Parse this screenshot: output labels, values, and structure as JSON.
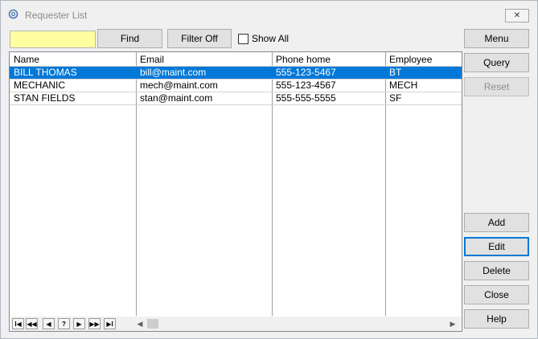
{
  "window": {
    "title": "Requester List",
    "close_label": "✕"
  },
  "toolbar": {
    "search_value": "",
    "find_label": "Find",
    "filter_label": "Filter Off",
    "show_all_label": "Show All",
    "show_all_checked": false
  },
  "grid": {
    "columns": [
      "Name",
      "Email",
      "Phone home",
      "Employee"
    ],
    "rows": [
      {
        "name": "BILL THOMAS",
        "email": "bill@maint.com",
        "phone": "555-123-5467",
        "employee": "BT",
        "selected": true
      },
      {
        "name": "MECHANIC",
        "email": "mech@maint.com",
        "phone": "555-123-4567",
        "employee": "MECH",
        "selected": false
      },
      {
        "name": "STAN FIELDS",
        "email": "stan@maint.com",
        "phone": "555-555-5555",
        "employee": "SF",
        "selected": false
      }
    ]
  },
  "navigator": {
    "first": "I◀",
    "prev_page": "◀◀",
    "prev": "◀",
    "search": "?",
    "next": "▶",
    "next_page": "▶▶",
    "last": "▶I"
  },
  "side_buttons": {
    "menu": "Menu",
    "query": "Query",
    "reset": "Reset",
    "add": "Add",
    "edit": "Edit",
    "delete": "Delete",
    "close": "Close",
    "help": "Help"
  },
  "colors": {
    "selection": "#0078d7",
    "search_bg": "#ffffa0",
    "focus_border": "#0078d7"
  }
}
